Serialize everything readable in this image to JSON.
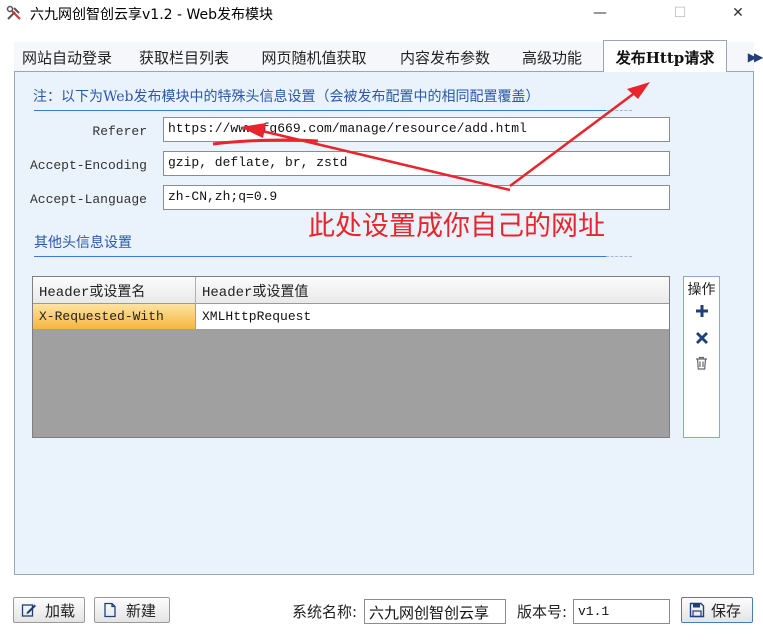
{
  "window": {
    "title": "六九网创智创云享v1.2 - Web发布模块",
    "minimize_glyph": "—",
    "maximize_glyph": "☐",
    "close_glyph": "✕"
  },
  "tabs": [
    {
      "label": "网站自动登录"
    },
    {
      "label": "获取栏目列表"
    },
    {
      "label": "网页随机值获取"
    },
    {
      "label": "内容发布参数"
    },
    {
      "label": "高级功能"
    },
    {
      "label": "发布Http请求",
      "active": true
    }
  ],
  "tab_scroll_glyph": "▶▶",
  "note": "注：以下为Web发布模块中的特殊头信息设置（会被发布配置中的相同配置覆盖）",
  "fields": {
    "referer": {
      "label": "Referer",
      "value": "https://www.fg669.com/manage/resource/add.html"
    },
    "accept_encoding": {
      "label": "Accept-Encoding",
      "value": "gzip, deflate, br, zstd"
    },
    "accept_language": {
      "label": "Accept-Language",
      "value": "zh-CN,zh;q=0.9"
    }
  },
  "annotation": {
    "text": "此处设置成你自己的网址",
    "color": "#e8242c"
  },
  "other_headers": {
    "title": "其他头信息设置",
    "columns": [
      "Header或设置名",
      "Header或设置值"
    ],
    "rows": [
      {
        "name": "X-Requested-With",
        "value": "XMLHttpRequest"
      }
    ]
  },
  "operations": {
    "title": "操作",
    "add": "plus-icon",
    "delete": "x-icon",
    "clear": "trash-icon"
  },
  "bottom": {
    "load_label": "加载",
    "new_label": "新建",
    "system_name_label": "系统名称:",
    "system_name_value": "六九网创智创云享",
    "version_label": "版本号:",
    "version_value": "v1.1",
    "save_label": "保存"
  },
  "colors": {
    "accent": "#2a58a8",
    "panel": "#eaf3fc",
    "selected_row": "#f5b640"
  }
}
